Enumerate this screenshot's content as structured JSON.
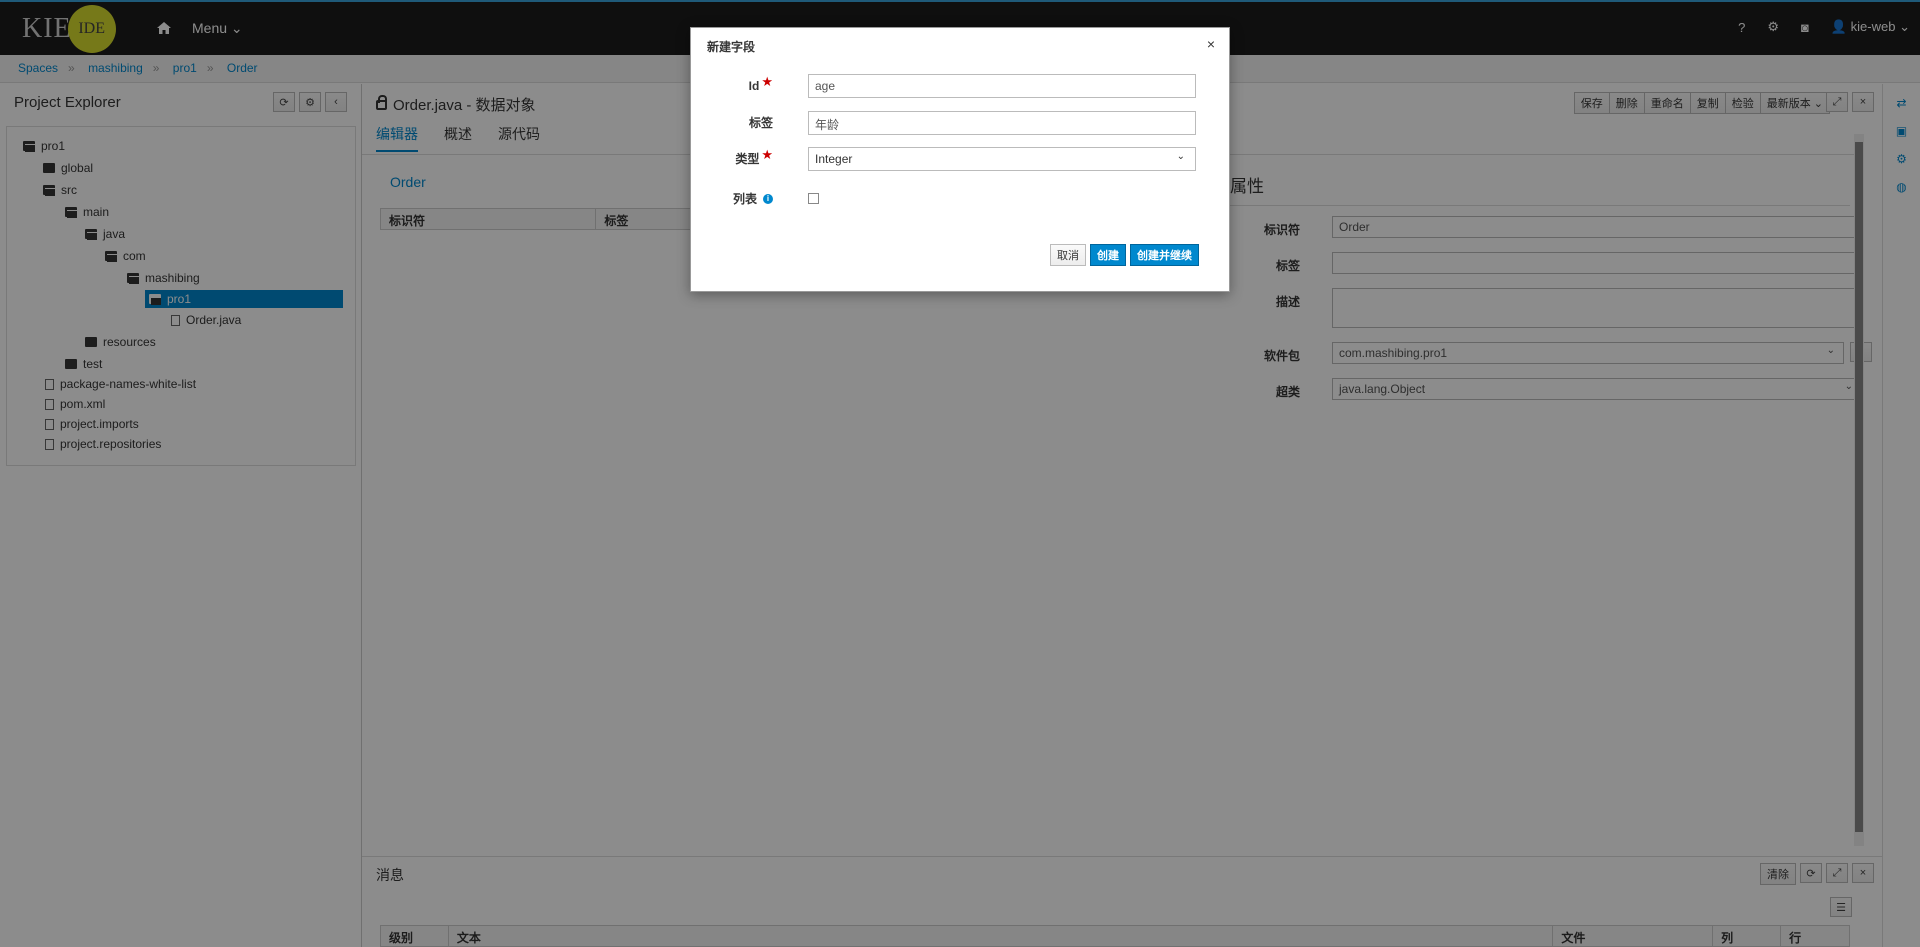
{
  "app": {
    "logo_kie": "KIE",
    "logo_ide": "IDE",
    "menu_label": "Menu",
    "user": "kie-web"
  },
  "breadcrumb": [
    "Spaces",
    "mashibing",
    "pro1",
    "Order"
  ],
  "explorer": {
    "title": "Project Explorer",
    "tree": [
      {
        "label": "pro1",
        "type": "folder-open"
      },
      {
        "label": "global",
        "type": "folder"
      },
      {
        "label": "src",
        "type": "folder-open"
      },
      {
        "label": "main",
        "type": "folder-open"
      },
      {
        "label": "java",
        "type": "folder-open"
      },
      {
        "label": "com",
        "type": "folder-open"
      },
      {
        "label": "mashibing",
        "type": "folder-open"
      },
      {
        "label": "pro1",
        "type": "folder-open",
        "selected": true
      },
      {
        "label": "Order.java",
        "type": "file"
      },
      {
        "label": "resources",
        "type": "folder"
      },
      {
        "label": "test",
        "type": "folder"
      },
      {
        "label": "package-names-white-list",
        "type": "file"
      },
      {
        "label": "pom.xml",
        "type": "file"
      },
      {
        "label": "project.imports",
        "type": "file"
      },
      {
        "label": "project.repositories",
        "type": "file"
      }
    ]
  },
  "editor": {
    "title": "Order.java - 数据对象",
    "actions": [
      "保存",
      "删除",
      "重命名",
      "复制",
      "检验",
      "最新版本"
    ],
    "tabs": [
      "编辑器",
      "概述",
      "源代码"
    ],
    "object_link": "Order",
    "fields_table_headers": [
      "标识符",
      "标签"
    ],
    "properties": {
      "title": "属性",
      "identifier_label": "标识符",
      "identifier_value": "Order",
      "label_label": "标签",
      "label_value": "",
      "desc_label": "描述",
      "desc_value": "",
      "package_label": "软件包",
      "package_value": "com.mashibing.pro1",
      "superclass_label": "超类",
      "superclass_value": "java.lang.Object"
    }
  },
  "messages": {
    "title": "消息",
    "clear": "清除",
    "headers": [
      "级别",
      "文本",
      "文件",
      "列",
      "行"
    ]
  },
  "modal": {
    "title": "新建字段",
    "close": "×",
    "id_label": "Id",
    "id_value": "age",
    "label_label": "标签",
    "label_value": "年龄",
    "type_label": "类型",
    "type_value": "Integer",
    "list_label": "列表",
    "list_checked": false,
    "cancel": "取消",
    "create": "创建",
    "create_continue": "创建并继续"
  }
}
